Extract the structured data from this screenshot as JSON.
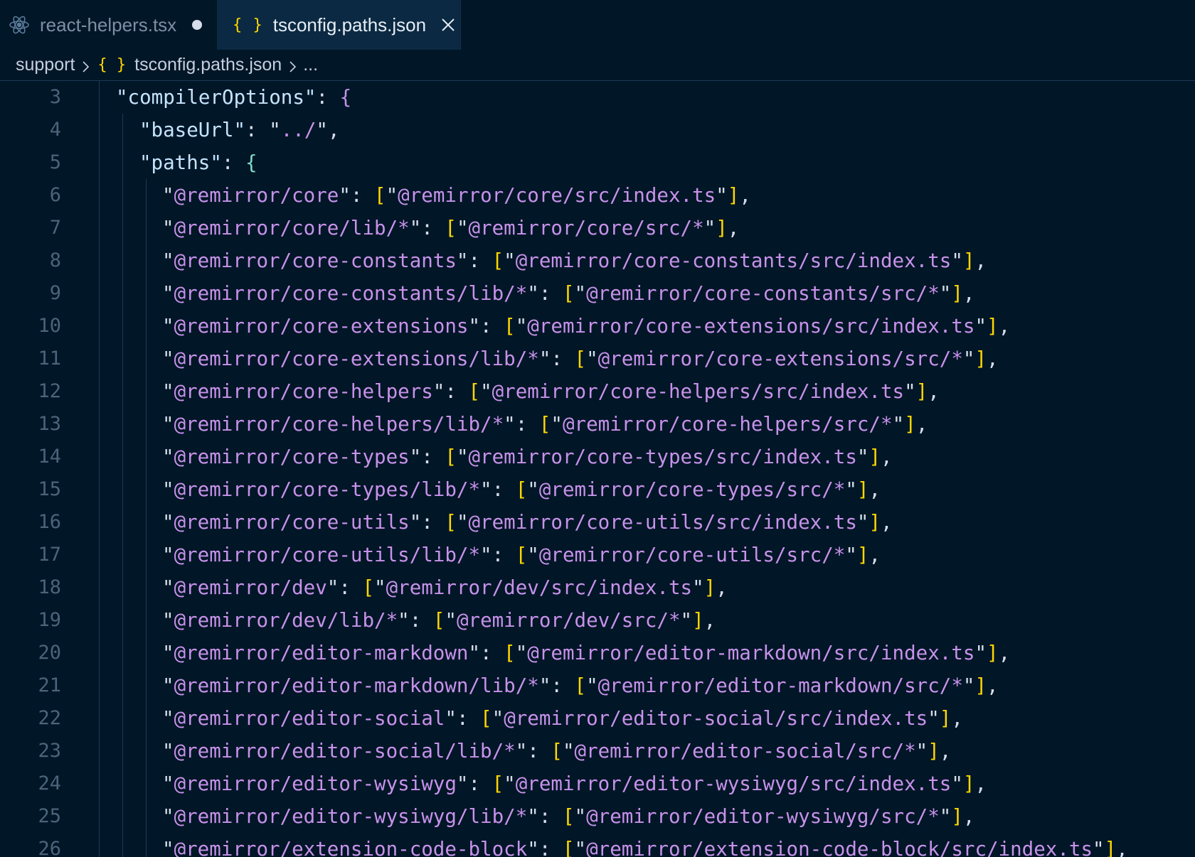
{
  "tabs": [
    {
      "label": "react-helpers.tsx",
      "icon": "react-icon",
      "dirty": true,
      "active": false
    },
    {
      "label": "tsconfig.paths.json",
      "icon": "json-braces-icon",
      "active": true
    }
  ],
  "breadcrumb": {
    "folder": "support",
    "json_icon_glyph": "{ }",
    "file": "tsconfig.paths.json",
    "more": "..."
  },
  "editor": {
    "lines": [
      {
        "n": "3"
      },
      {
        "n": "4"
      },
      {
        "n": "5"
      },
      {
        "n": "6"
      },
      {
        "n": "7"
      },
      {
        "n": "8"
      },
      {
        "n": "9"
      },
      {
        "n": "10"
      },
      {
        "n": "11"
      },
      {
        "n": "12"
      },
      {
        "n": "13"
      },
      {
        "n": "14"
      },
      {
        "n": "15"
      },
      {
        "n": "16"
      },
      {
        "n": "17"
      },
      {
        "n": "18"
      },
      {
        "n": "19"
      },
      {
        "n": "20"
      },
      {
        "n": "21"
      },
      {
        "n": "22"
      },
      {
        "n": "23"
      },
      {
        "n": "24"
      },
      {
        "n": "25"
      },
      {
        "n": "26"
      }
    ],
    "compiler_key": "compilerOptions",
    "base_url_key": "baseUrl",
    "base_url_value": "../",
    "paths_key": "paths",
    "path_entries": [
      {
        "key": "@remirror/core",
        "value": "@remirror/core/src/index.ts"
      },
      {
        "key": "@remirror/core/lib/*",
        "value": "@remirror/core/src/*"
      },
      {
        "key": "@remirror/core-constants",
        "value": "@remirror/core-constants/src/index.ts"
      },
      {
        "key": "@remirror/core-constants/lib/*",
        "value": "@remirror/core-constants/src/*"
      },
      {
        "key": "@remirror/core-extensions",
        "value": "@remirror/core-extensions/src/index.ts"
      },
      {
        "key": "@remirror/core-extensions/lib/*",
        "value": "@remirror/core-extensions/src/*"
      },
      {
        "key": "@remirror/core-helpers",
        "value": "@remirror/core-helpers/src/index.ts"
      },
      {
        "key": "@remirror/core-helpers/lib/*",
        "value": "@remirror/core-helpers/src/*"
      },
      {
        "key": "@remirror/core-types",
        "value": "@remirror/core-types/src/index.ts"
      },
      {
        "key": "@remirror/core-types/lib/*",
        "value": "@remirror/core-types/src/*"
      },
      {
        "key": "@remirror/core-utils",
        "value": "@remirror/core-utils/src/index.ts"
      },
      {
        "key": "@remirror/core-utils/lib/*",
        "value": "@remirror/core-utils/src/*"
      },
      {
        "key": "@remirror/dev",
        "value": "@remirror/dev/src/index.ts"
      },
      {
        "key": "@remirror/dev/lib/*",
        "value": "@remirror/dev/src/*"
      },
      {
        "key": "@remirror/editor-markdown",
        "value": "@remirror/editor-markdown/src/index.ts"
      },
      {
        "key": "@remirror/editor-markdown/lib/*",
        "value": "@remirror/editor-markdown/src/*"
      },
      {
        "key": "@remirror/editor-social",
        "value": "@remirror/editor-social/src/index.ts"
      },
      {
        "key": "@remirror/editor-social/lib/*",
        "value": "@remirror/editor-social/src/*"
      },
      {
        "key": "@remirror/editor-wysiwyg",
        "value": "@remirror/editor-wysiwyg/src/index.ts"
      },
      {
        "key": "@remirror/editor-wysiwyg/lib/*",
        "value": "@remirror/editor-wysiwyg/src/*"
      },
      {
        "key": "@remirror/extension-code-block",
        "value": "@remirror/extension-code-block/src/index.ts"
      }
    ]
  },
  "colors": {
    "background": "#011627",
    "active_tab": "#0b2942",
    "json_icon": "#ffd700",
    "path_string": "#c792ea",
    "bracket": "#ffd700"
  }
}
